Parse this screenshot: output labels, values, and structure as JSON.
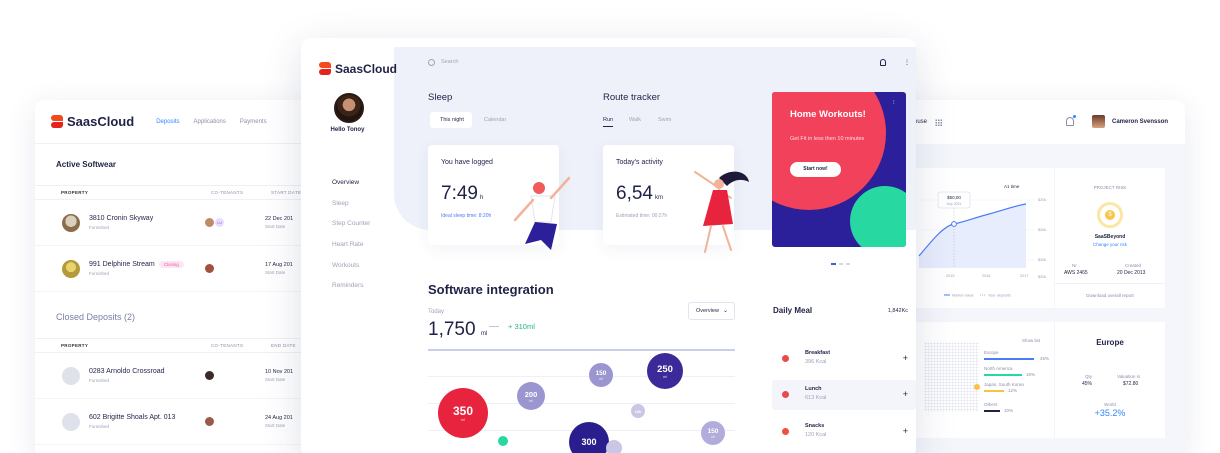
{
  "left_card": {
    "brand": "SaasCloud",
    "nav": [
      "Deposits",
      "Applications",
      "Payments"
    ],
    "active_title": "Active Softwear",
    "columns": [
      "PROPERTY",
      "CO-TENANTS",
      "START DATE"
    ],
    "active_rows": [
      {
        "name": "3810 Cronin Skyway",
        "sub": "Furnished",
        "badge": "",
        "date": "22 Dec 201",
        "date_sub": "Start Date"
      },
      {
        "name": "991 Delphine Stream",
        "sub": "Furnished",
        "badge": "Closing",
        "date": "17 Aug 201",
        "date_sub": "Start Date"
      }
    ],
    "closed_title": "Closed Deposits (2)",
    "closed_columns": [
      "PROPERTY",
      "CO-TENANTS",
      "END DATE"
    ],
    "closed_rows": [
      {
        "name": "0283 Arnoldo Crossroad",
        "sub": "Furnished",
        "date": "10 Nov 201",
        "date_sub": "Start Date"
      },
      {
        "name": "602 Brigitte Shoals Apt. 013",
        "sub": "Furnished",
        "date": "24 Aug 201",
        "date_sub": "Start Date"
      }
    ],
    "avatar_initials": "LU"
  },
  "dashboard": {
    "brand": "SaasCloud",
    "search_placeholder": "Search",
    "user_greeting": "Hello Tonoy",
    "menu": [
      "Overview",
      "Sleep",
      "Step Counter",
      "Heart Rate",
      "Workouts",
      "Reminders"
    ],
    "sleep": {
      "title": "Sleep",
      "tabs": [
        "This night",
        "Calendar"
      ],
      "card_title": "You have logged",
      "value": "7:49",
      "unit": "h",
      "sub": "Ideal sleep time: 8:20h"
    },
    "route": {
      "title": "Route tracker",
      "tabs": [
        "Run",
        "Walk",
        "Swim"
      ],
      "card_title": "Today's activity",
      "value": "6,54",
      "unit": "km",
      "sub": "Estimated time: 00:27h"
    },
    "promo": {
      "title": "Home Workouts!",
      "subtitle": "Get Fit in less then 10 minutes",
      "button": "Start now!"
    },
    "software": {
      "title": "Software integration",
      "today": "Today",
      "value": "1,750",
      "unit": "ml",
      "delta": "+ 310ml",
      "select": "Overview",
      "bubbles": [
        {
          "value": "350",
          "unit": "ml",
          "color": "#e8233d"
        },
        {
          "value": "200",
          "unit": "ml",
          "color": "#9c96d0"
        },
        {
          "value": "150",
          "unit": "ml",
          "color": "#9c96d0"
        },
        {
          "value": "250",
          "unit": "ml",
          "color": "#3c2a9b"
        },
        {
          "value": "10k",
          "unit": "",
          "color": "#c9c6e6"
        },
        {
          "value": "150",
          "unit": "ml",
          "color": "#b1acdb"
        },
        {
          "value": "300",
          "unit": "",
          "color": "#2a1d8e"
        }
      ]
    },
    "meal": {
      "title": "Daily Meal",
      "total": "1,842Kc",
      "items": [
        {
          "name": "Breakfast",
          "kcal": "396 Kcal"
        },
        {
          "name": "Lunch",
          "kcal": "613 Kcal"
        },
        {
          "name": "Snacks",
          "kcal": "120 Kcal"
        }
      ]
    }
  },
  "right_card": {
    "house_label": "ouse",
    "user": "Cameron Svensson",
    "chart": {
      "tooltip_value": "$50,00",
      "tooltip_date": "July 2021",
      "range": "A1 time",
      "y_ticks": [
        "$20k",
        "$20k",
        "$20k",
        "$20k"
      ],
      "x_ticks": [
        "2015",
        "2016",
        "2017"
      ],
      "legend": [
        "Market value",
        "Your deposits"
      ]
    },
    "risk": {
      "label": "PROJECT RISK",
      "brand": "SaaSBeyond",
      "link": "Change your risk",
      "nr_label": "Nr",
      "nr_value": "AWS 2465",
      "created_label": "Created",
      "created_value": "20 Dec 2013",
      "download": "Download overall report"
    },
    "map": {
      "show_list": "Show list",
      "regions": [
        {
          "name": "Europe",
          "pct": "45%"
        },
        {
          "name": "North America",
          "pct": "15%"
        },
        {
          "name": "Japan, South Korea",
          "pct": "12%"
        },
        {
          "name": "Others",
          "pct": "10%"
        }
      ]
    },
    "europe": {
      "title": "Europe",
      "qty_label": "Qty",
      "qty_value": "45%",
      "valuation_label": "Valuation in",
      "valuation_value": "$72.80",
      "world_label": "World",
      "world_value": "+35.2%"
    }
  },
  "colors": {
    "accent": "#2f86ff",
    "brand_red": "#e3231c",
    "indigo": "#2c1f9a",
    "coral": "#f2415a",
    "mint": "#27d8a0",
    "success": "#1fb87a"
  }
}
